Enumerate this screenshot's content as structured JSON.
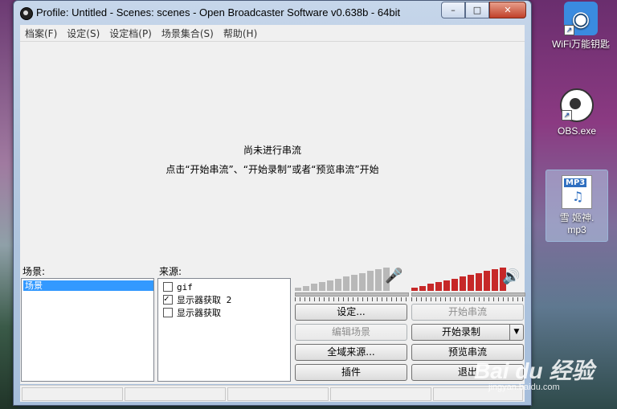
{
  "window": {
    "title": "Profile: Untitled - Scenes: scenes - Open Broadcaster Software v0.638b - 64bit",
    "minimize": "–",
    "maximize": "□",
    "close": "✕"
  },
  "menu": [
    "档案(F)",
    "设定(S)",
    "设定档(P)",
    "场景集合(S)",
    "帮助(H)"
  ],
  "preview": {
    "line1": "尚未进行串流",
    "line2": "点击“开始串流”、“开始录制”或者“预览串流”开始"
  },
  "scenes": {
    "label": "场景:",
    "items": [
      "场景"
    ],
    "selected": "场景"
  },
  "sources": {
    "label": "来源:",
    "items": [
      {
        "name": "gif",
        "checked": false
      },
      {
        "name": "显示器获取 2",
        "checked": true
      },
      {
        "name": "显示器获取",
        "checked": false
      }
    ]
  },
  "buttons": {
    "settings": "设定...",
    "start_stream": "开始串流",
    "edit_scene": "编辑场景",
    "start_record": "开始录制",
    "global_sources": "全域来源...",
    "preview_stream": "预览串流",
    "plugins": "插件",
    "exit": "退出"
  },
  "desktop": {
    "wifi_label": "WiFi万能钥匙",
    "obs_label": "OBS.exe",
    "mp3_tag": "MP3",
    "mp3_label_1": "雪  姬神.",
    "mp3_label_2": "mp3"
  },
  "watermark": {
    "brand": "Bai du 经验",
    "url": "jingyan.baidu.com"
  },
  "colors": {
    "mic_meter": "#b8b8b8",
    "desktop_meter": "#c62828",
    "selection": "#3399ff"
  }
}
